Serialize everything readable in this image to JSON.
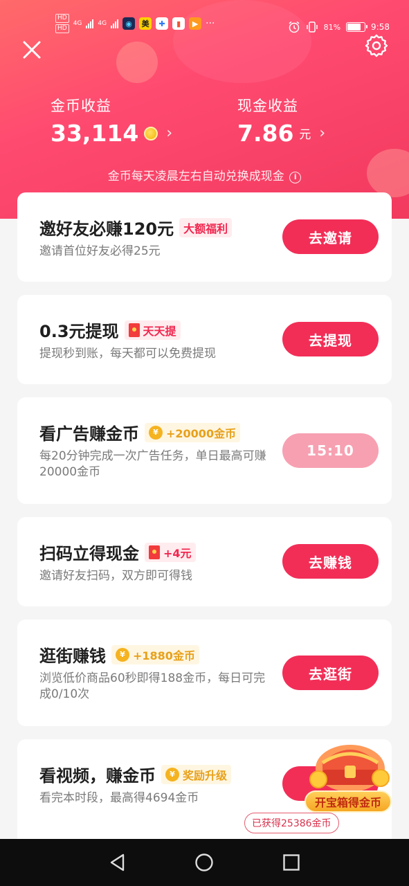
{
  "statusbar": {
    "hd1": "HD",
    "hd2": "HD",
    "net1": "4G",
    "net2": "4G",
    "app_meituan": "美",
    "more": "···",
    "battery_pct": "81%",
    "battery_level": 0.81,
    "time": "9:58"
  },
  "header": {
    "coin_label": "金币收益",
    "coin_value": "33,114",
    "cash_label": "现金收益",
    "cash_value": "7.86",
    "cash_unit": "元",
    "chevron": "›",
    "notice": "金币每天凌晨左右自动兑换成现金",
    "info_glyph": "i"
  },
  "tasks": [
    {
      "title": "邀好友必赚120元",
      "badge": "大额福利",
      "desc": "邀请首位好友必得25元",
      "button": "去邀请"
    },
    {
      "title": "0.3元提现",
      "badge": "天天提",
      "desc": "提现秒到账，每天都可以免费提现",
      "button": "去提现"
    },
    {
      "title": "看广告赚金币",
      "badge": "+20000金币",
      "desc": "每20分钟完成一次广告任务，单日最高可赚20000金币",
      "button": "15:10"
    },
    {
      "title": "扫码立得现金",
      "badge": "+4元",
      "desc": "邀请好友扫码，双方即可得钱",
      "button": "去赚钱"
    },
    {
      "title": "逛街赚钱",
      "badge": "+1880金币",
      "desc": "浏览低价商品60秒即得188金币，每日可完成0/10次",
      "button": "去逛街"
    },
    {
      "title": "看视频，赚金币",
      "badge": "奖励升级",
      "desc": "看完本时段，最高得4694金币",
      "button": ""
    }
  ],
  "coin_symbol": "¥",
  "treasure": {
    "label": "开宝箱得金币",
    "earned": "已获得25386金币"
  },
  "colors": {
    "accent": "#f22e57",
    "accent_disabled": "#f7a0b1",
    "gold": "#e7a11b",
    "hero_start": "#ff6a6a",
    "hero_end": "#f2395e"
  }
}
